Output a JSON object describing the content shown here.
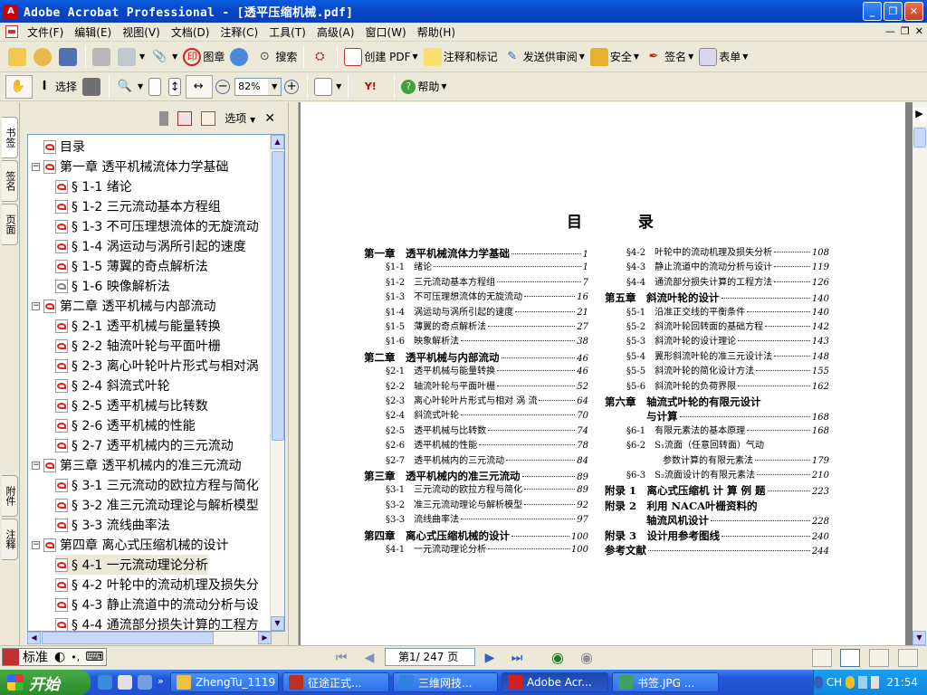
{
  "window": {
    "title": "Adobe Acrobat Professional - [透平压缩机械.pdf]",
    "app_icon": "acrobat-icon"
  },
  "menu": [
    "文件(F)",
    "编辑(E)",
    "视图(V)",
    "文档(D)",
    "注释(C)",
    "工具(T)",
    "高级(A)",
    "窗口(W)",
    "帮助(H)"
  ],
  "toolbar1": {
    "stamp": "图章",
    "search": "搜索",
    "create_pdf": "创建 PDF",
    "comment": "注释和标记",
    "review": "发送供审阅",
    "security": "安全",
    "sign": "签名",
    "forms": "表单"
  },
  "toolbar2": {
    "select": "选择",
    "zoom": "82%",
    "help": "帮助"
  },
  "nav_tabs": [
    "书签",
    "签名",
    "页面",
    "附件",
    "注释"
  ],
  "panel": {
    "options": "选项"
  },
  "bookmarks": [
    {
      "label": "目录",
      "level": 0,
      "exp": ""
    },
    {
      "label": "第一章 透平机械流体力学基础",
      "level": 0,
      "exp": "−"
    },
    {
      "label": "§ 1-1 绪论",
      "level": 1,
      "exp": ""
    },
    {
      "label": "§ 1-2 三元流动基本方程组",
      "level": 1,
      "exp": ""
    },
    {
      "label": "§ 1-3 不可压理想流体的无旋流动",
      "level": 1,
      "exp": ""
    },
    {
      "label": "§ 1-4 涡运动与涡所引起的速度",
      "level": 1,
      "exp": ""
    },
    {
      "label": "§ 1-5 薄翼的奇点解析法",
      "level": 1,
      "exp": ""
    },
    {
      "label": "§ 1-6 映像解析法",
      "level": 1,
      "exp": "",
      "gray": true
    },
    {
      "label": "第二章 透平机械与内部流动",
      "level": 0,
      "exp": "−"
    },
    {
      "label": "§ 2-1 透平机械与能量转换",
      "level": 1,
      "exp": ""
    },
    {
      "label": "§ 2-2 轴流叶轮与平面叶栅",
      "level": 1,
      "exp": ""
    },
    {
      "label": "§ 2-3 离心叶轮叶片形式与相对涡",
      "level": 1,
      "exp": ""
    },
    {
      "label": "§ 2-4 斜流式叶轮",
      "level": 1,
      "exp": ""
    },
    {
      "label": "§ 2-5 透平机械与比转数",
      "level": 1,
      "exp": ""
    },
    {
      "label": "§ 2-6 透平机械的性能",
      "level": 1,
      "exp": ""
    },
    {
      "label": "§ 2-7 透平机械内的三元流动",
      "level": 1,
      "exp": ""
    },
    {
      "label": "第三章 透平机械内的准三元流动",
      "level": 0,
      "exp": "−"
    },
    {
      "label": "§ 3-1 三元流动的欧拉方程与简化",
      "level": 1,
      "exp": ""
    },
    {
      "label": "§ 3-2 准三元流动理论与解析模型",
      "level": 1,
      "exp": ""
    },
    {
      "label": "§ 3-3 流线曲率法",
      "level": 1,
      "exp": ""
    },
    {
      "label": "第四章 离心式压缩机械的设计",
      "level": 0,
      "exp": "−"
    },
    {
      "label": "§ 4-1 一元流动理论分析",
      "level": 1,
      "exp": "",
      "selected": true
    },
    {
      "label": "§ 4-2 叶轮中的流动机理及损失分",
      "level": 1,
      "exp": ""
    },
    {
      "label": "§ 4-3 静止流道中的流动分析与设",
      "level": 1,
      "exp": ""
    },
    {
      "label": "§ 4-4 通流部分损失计算的工程方",
      "level": 1,
      "exp": ""
    }
  ],
  "page": {
    "toc_title": "目 录",
    "left_col": [
      {
        "l": "第一章　透平机械流体力学基础",
        "p": "1",
        "ch": true
      },
      {
        "l": "§1-1　绪论",
        "p": "1"
      },
      {
        "l": "§1-2　三元流动基本方程组",
        "p": "7"
      },
      {
        "l": "§1-3　不可压理想流体的无旋流动",
        "p": "16"
      },
      {
        "l": "§1-4　涡运动与涡所引起的速度",
        "p": "21"
      },
      {
        "l": "§1-5　薄翼的奇点解析法",
        "p": "27"
      },
      {
        "l": "§1-6　映象解析法",
        "p": "38"
      },
      {
        "l": "第二章　透平机械与内部流动",
        "p": "46",
        "ch": true
      },
      {
        "l": "§2-1　透平机械与能量转换",
        "p": "46"
      },
      {
        "l": "§2-2　轴流叶轮与平面叶栅",
        "p": "52"
      },
      {
        "l": "§2-3　离心叶轮叶片形式与相对 涡 流",
        "p": "64"
      },
      {
        "l": "§2-4　斜流式叶轮",
        "p": "70"
      },
      {
        "l": "§2-5　透平机械与比转数",
        "p": "74"
      },
      {
        "l": "§2-6　透平机械的性能",
        "p": "78"
      },
      {
        "l": "§2-7　透平机械内的三元流动",
        "p": "84"
      },
      {
        "l": "第三章　透平机械内的准三元流动",
        "p": "89",
        "ch": true
      },
      {
        "l": "§3-1　三元流动的欧拉方程与简化",
        "p": "89"
      },
      {
        "l": "§3-2　准三元流动理论与解析模型",
        "p": "92"
      },
      {
        "l": "§3-3　流线曲率法",
        "p": "97"
      },
      {
        "l": "第四章　离心式压缩机械的设计",
        "p": "100",
        "ch": true
      },
      {
        "l": "§4-1　一元流动理论分析",
        "p": "100"
      }
    ],
    "right_col": [
      {
        "l": "§4-2　叶轮中的流动机理及损失分析",
        "p": "108"
      },
      {
        "l": "§4-3　静止流道中的流动分析与设计",
        "p": "119"
      },
      {
        "l": "§4-4　通流部分损失计算的工程方法",
        "p": "126"
      },
      {
        "l": "第五章　斜流叶轮的设计",
        "p": "140",
        "ch": true
      },
      {
        "l": "§5-1　沿准正交线的平衡条件",
        "p": "140"
      },
      {
        "l": "§5-2　斜流叶轮回转面的基础方程",
        "p": "142"
      },
      {
        "l": "§5-3　斜流叶轮的设计理论",
        "p": "143"
      },
      {
        "l": "§5-4　翼形斜流叶轮的准三元设计法",
        "p": "148"
      },
      {
        "l": "§5-5　斜流叶轮的简化设计方法",
        "p": "155"
      },
      {
        "l": "§5-6　斜流叶轮的负荷界限",
        "p": "162"
      },
      {
        "l": "第六章　轴流式叶轮的有限元设计",
        "p": "",
        "ch": true,
        "noleader": true
      },
      {
        "l": "　　　　与计算",
        "p": "168",
        "ch": true
      },
      {
        "l": "§6-1　有限元素法的基本原理",
        "p": "168"
      },
      {
        "l": "§6-2　S₁流面（任意回转面）气动",
        "p": "",
        "noleader": true
      },
      {
        "l": "　　　　参数计算的有限元素法",
        "p": "179"
      },
      {
        "l": "§6-3　S₂流面设计的有限元素法",
        "p": "210"
      },
      {
        "l": "附录 1　离心式压缩机 计 算 例 题",
        "p": "223",
        "ch": true
      },
      {
        "l": "附录 2　利用 NACA叶栅资料的",
        "p": "",
        "ch": true,
        "noleader": true
      },
      {
        "l": "　　　　轴流风机设计",
        "p": "228",
        "ch": true
      },
      {
        "l": "附录 3　设计用参考图线",
        "p": "240",
        "ch": true
      },
      {
        "l": "参考文献",
        "p": "244",
        "ch": true
      }
    ]
  },
  "status": {
    "page_indicator": "第1/ 247 页",
    "ime": "标准"
  },
  "taskbar": {
    "start": "开始",
    "items": [
      {
        "label": "ZhengTu_1119",
        "icon": "folder-icon",
        "color": "#f0c040"
      },
      {
        "label": "征途正式...",
        "icon": "game-icon",
        "color": "#c03020"
      },
      {
        "label": "三维网技...",
        "icon": "browser-icon",
        "color": "#3080e0"
      },
      {
        "label": "Adobe Acr...",
        "icon": "acrobat-icon",
        "color": "#d02020",
        "active": true
      },
      {
        "label": "书签.JPG ...",
        "icon": "image-icon",
        "color": "#40a060"
      }
    ],
    "lang": "CH",
    "clock": "21:54"
  },
  "colors": {
    "titlebar": "#0848c8",
    "taskbar": "#2458d8",
    "start": "#3a9a3a",
    "accent_red": "#d02020"
  }
}
